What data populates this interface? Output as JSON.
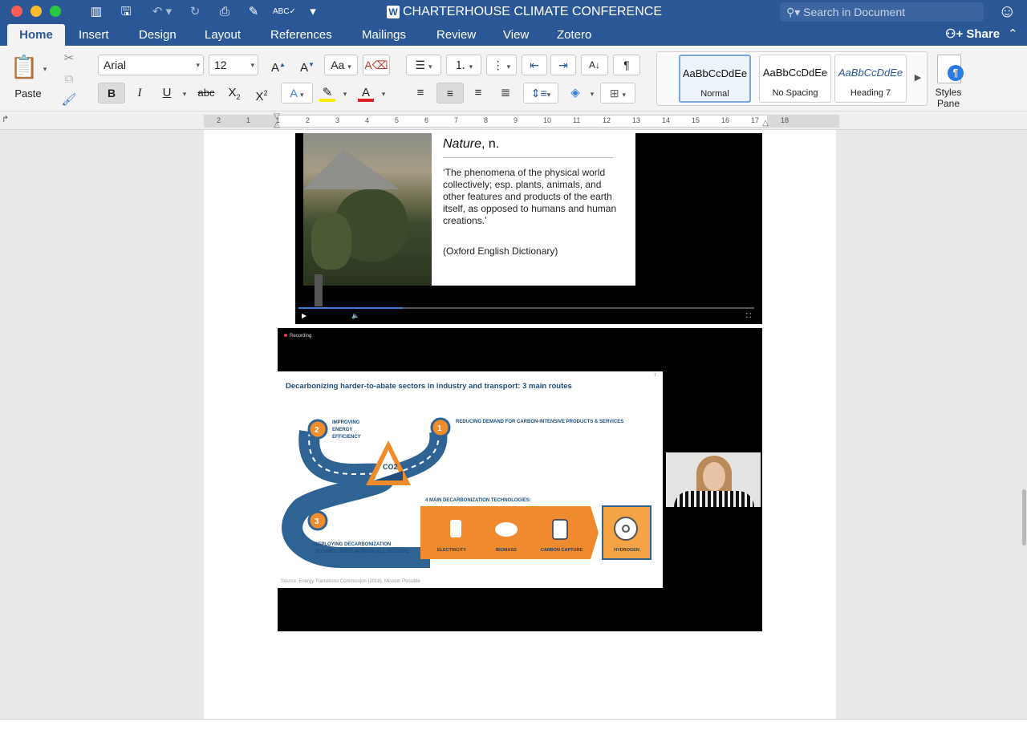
{
  "titlebar": {
    "doc_title": "CHARTERHOUSE CLIMATE CONFERENCE",
    "search_placeholder": "Search in Document",
    "share_label": "Share",
    "traffic_colors": [
      "#fe5f57",
      "#febc2e",
      "#28c840"
    ]
  },
  "tabs": [
    "Home",
    "Insert",
    "Design",
    "Layout",
    "References",
    "Mailings",
    "Review",
    "View",
    "Zotero"
  ],
  "ribbon": {
    "paste_label": "Paste",
    "font_name": "Arial",
    "font_size": "12",
    "styles": [
      {
        "sample": "AaBbCcDdEe",
        "name": "Normal"
      },
      {
        "sample": "AaBbCcDdEe",
        "name": "No Spacing"
      },
      {
        "sample": "AaBbCcDdEe",
        "name": "Heading 7"
      }
    ],
    "styles_pane_label": "Styles Pane"
  },
  "ruler": {
    "ticks": [
      "2",
      "1",
      "1",
      "2",
      "3",
      "4",
      "5",
      "6",
      "7",
      "8",
      "9",
      "10",
      "11",
      "12",
      "13",
      "14",
      "15",
      "16",
      "17",
      "18"
    ]
  },
  "video1": {
    "heading_word": "Nature",
    "heading_pos": ", n.",
    "definition": "‘The phenomena of the physical world collectively; esp. plants, animals, and other features and products of the earth itself, as opposed to humans and human creations.’",
    "source": "(Oxford English Dictionary)"
  },
  "video2": {
    "recording_label": "Recording",
    "slide_title": "Decarbonizing harder-to-abate sectors in industry and transport: 3 main routes",
    "page_number": "7",
    "routes": [
      {
        "number": "1",
        "label": "REDUCING DEMAND FOR CARBON-INTENSIVE PRODUCTS & SERVICES"
      },
      {
        "number": "2",
        "label": "IMPROVING ENERGY EFFICIENCY"
      },
      {
        "number": "3",
        "label": "DEPLOYING DECARBONIZATION TECHNOLOGIES ACROSS ALL SECTORS"
      }
    ],
    "tech_heading": "4 MAIN DECARBONIZATION TECHNOLOGIES:",
    "technologies": [
      "ELECTRICITY",
      "BIOMASS",
      "CARBON CAPTURE",
      "HYDROGEN"
    ],
    "co2_label": "CO2",
    "source_note": "Source: Energy Transitions Commission (2018), Mission Possible"
  }
}
